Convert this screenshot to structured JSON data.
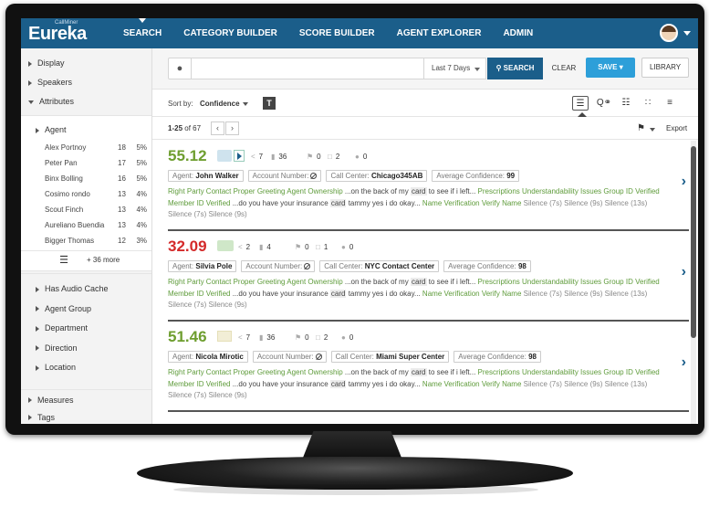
{
  "brand": {
    "sub": "CallMiner",
    "main": "Eureka"
  },
  "nav": [
    "SEARCH",
    "CATEGORY BUILDER",
    "SCORE BUILDER",
    "AGENT EXPLORER",
    "ADMIN"
  ],
  "sidebar": {
    "display": "Display",
    "speakers": "Speakers",
    "attributes": "Attributes",
    "agent": "Agent",
    "agents": [
      {
        "name": "Alex Portnoy",
        "count": "18",
        "pct": "5%"
      },
      {
        "name": "Peter Pan",
        "count": "17",
        "pct": "5%"
      },
      {
        "name": "Binx Bolling",
        "count": "16",
        "pct": "5%"
      },
      {
        "name": "Cosimo rondo",
        "count": "13",
        "pct": "4%"
      },
      {
        "name": "Scout Finch",
        "count": "13",
        "pct": "4%"
      },
      {
        "name": "Aureliano Buendia",
        "count": "13",
        "pct": "4%"
      },
      {
        "name": "Bigger Thomas",
        "count": "12",
        "pct": "3%"
      }
    ],
    "more": "+ 36 more",
    "attr_items": [
      "Has Audio Cache",
      "Agent Group",
      "Department",
      "Direction",
      "Location"
    ],
    "measures": "Measures",
    "tags": "Tags"
  },
  "search": {
    "placeholder": "",
    "range": "Last 7 Days",
    "search_label": "SEARCH",
    "clear_label": "CLEAR",
    "save_label": "SAVE",
    "library_label": "LIBRARY"
  },
  "toolbar": {
    "sort_by": "Sort by:",
    "sort_value": "Confidence",
    "t_label": "T"
  },
  "pager": {
    "range": "1-25",
    "of": "of",
    "total": "67",
    "export": "Export"
  },
  "results": [
    {
      "score": "55.12",
      "shares": "7",
      "comments": "36",
      "tags": "0",
      "docs": "2",
      "chats": "0",
      "agent_label": "Agent:",
      "agent": "John Walker",
      "account_label": "Account Number:",
      "center_label": "Call Center:",
      "center": "Chicago345AB",
      "conf_label": "Average Confidence:",
      "conf": "99"
    },
    {
      "score": "32.09",
      "shares": "2",
      "comments": "4",
      "tags": "0",
      "docs": "1",
      "chats": "0",
      "agent_label": "Agent:",
      "agent": "Silvia Pole",
      "account_label": "Account Number:",
      "center_label": "Call Center:",
      "center": "NYC Contact Center",
      "conf_label": "Average Confidence:",
      "conf": "98"
    },
    {
      "score": "51.46",
      "shares": "7",
      "comments": "36",
      "tags": "0",
      "docs": "2",
      "chats": "0",
      "agent_label": "Agent:",
      "agent": "Nicola Mirotic",
      "account_label": "Account Number:",
      "center_label": "Call Center:",
      "center": "Miami Super Center",
      "conf_label": "Average Confidence:",
      "conf": "98"
    }
  ],
  "snippet": {
    "cat1": "Right Party Contact Proper Greeting Agent Ownership",
    "text1a": "...on the back of my",
    "hl": "card",
    "text1b": "to see if i left...",
    "cat2": "Prescriptions Understandability Issues Group ID Verified Member ID Verified",
    "text2a": "...do you have your insurance",
    "text2b": "tammy yes i do okay...",
    "cat3": "Name Verification Verify Name",
    "silence": [
      "Silence (7s)",
      "Silence (9s)",
      "Silence (13s)",
      "Silence (7s)",
      "Silence (9s)"
    ]
  },
  "colors": {
    "nav": "#1b5e8a",
    "accent": "#2d9fd9",
    "green": "#6e9e2f",
    "red": "#d42a2a"
  }
}
